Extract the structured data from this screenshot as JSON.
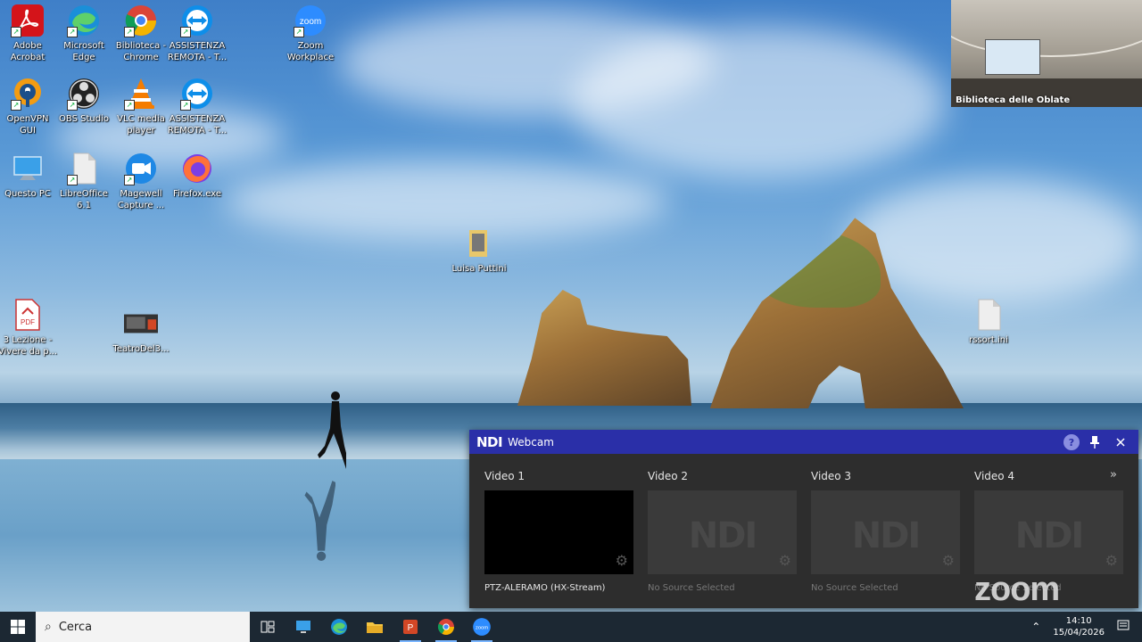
{
  "desktop_icons": [
    {
      "label": "Adobe\nAcrobat",
      "icon": "adobe-acrobat-icon"
    },
    {
      "label": "Microsoft\nEdge",
      "icon": "edge-icon"
    },
    {
      "label": "Biblioteca -\nChrome",
      "icon": "chrome-icon"
    },
    {
      "label": "ASSISTENZA\nREMOTA - T...",
      "icon": "teamviewer-icon"
    },
    {
      "label": "Zoom\nWorkplace",
      "icon": "zoom-icon"
    },
    {
      "label": "OpenVPN\nGUI",
      "icon": "openvpn-icon"
    },
    {
      "label": "OBS Studio",
      "icon": "obs-icon"
    },
    {
      "label": "VLC media\nplayer",
      "icon": "vlc-icon"
    },
    {
      "label": "ASSISTENZA\nREMOTA - T...",
      "icon": "teamviewer-icon"
    },
    {
      "label": "Questo PC",
      "icon": "computer-icon"
    },
    {
      "label": "LibreOffice\n6.1",
      "icon": "libreoffice-icon"
    },
    {
      "label": "Magewell\nCapture ...",
      "icon": "magewell-icon"
    },
    {
      "label": "Firefox.exe",
      "icon": "firefox-icon"
    },
    {
      "label": "Luisa Puttini",
      "icon": "folder-icon"
    },
    {
      "label": "3 Lezione -\nVivere da p...",
      "icon": "pdf-icon"
    },
    {
      "label": "TeatroDel3...",
      "icon": "pptx-icon"
    },
    {
      "label": "rssort.ini",
      "icon": "ini-file-icon"
    }
  ],
  "ndi_window": {
    "logo": "NDI",
    "title": "Webcam",
    "help": "?",
    "more": "»",
    "videos": [
      {
        "label": "Video 1",
        "source": "PTZ-ALERAMO (HX-Stream)",
        "ghost": ""
      },
      {
        "label": "Video 2",
        "source": "No Source Selected",
        "ghost": "NDI"
      },
      {
        "label": "Video 3",
        "source": "No Source Selected",
        "ghost": "NDI"
      },
      {
        "label": "Video 4",
        "source": "No Source Selected",
        "ghost": "NDI"
      }
    ]
  },
  "zoom_watermark": "zoom",
  "camera_preview": {
    "name": "Biblioteca delle Oblate"
  },
  "taskbar": {
    "search_placeholder": "Cerca",
    "time": "14:10",
    "date": "15/04/2026",
    "apps": [
      "task-view-icon",
      "remote-desktop-icon",
      "edge-icon",
      "file-explorer-icon",
      "powerpoint-icon",
      "chrome-icon",
      "zoom-icon"
    ]
  },
  "colors": {
    "ndi_title": "#2a2fa8",
    "taskbar": "#1c2833",
    "accent": "#7ab6ff"
  }
}
